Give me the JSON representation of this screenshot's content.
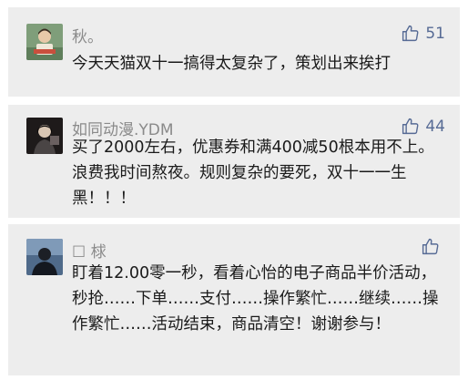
{
  "comments": [
    {
      "name": "秋。",
      "likes": "51",
      "text": "今天天猫双十一搞得太复杂了，策划出来挨打",
      "avatar": "avatar-reading-figure"
    },
    {
      "name": "如同动漫.YDM",
      "likes": "44",
      "text": "买了2000左右，优惠券和满400减50根本用不上。浪费我时间熬夜。规则复杂的要死，双十一一生黑！！！",
      "avatar": "avatar-dark-figure"
    },
    {
      "name": "☐ 梂",
      "likes": "",
      "text": "盯着12.00零一秒，看着心怡的电子商品半价活动，秒抢……下单……支付……操作繁忙……继续……操作繁忙……活动结束，商品清空！谢谢参与！",
      "avatar": "avatar-silhouette"
    }
  ],
  "colors": {
    "card_bg": "#ededed",
    "name": "#8a8a8a",
    "like": "#576b95",
    "text": "#1a1a1a"
  },
  "icons": {
    "like": "thumbs-up-outline-icon"
  }
}
